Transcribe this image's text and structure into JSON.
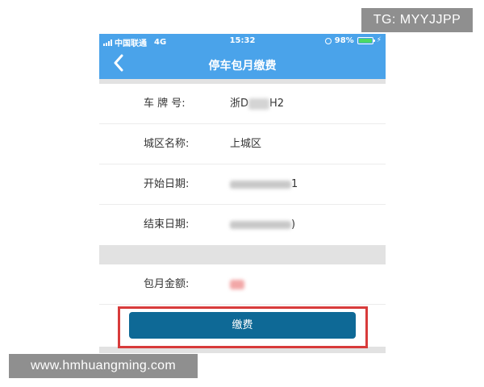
{
  "watermarks": {
    "top": "TG: MYYJJPP",
    "bottom": "www.hmhuangming.com"
  },
  "status_bar": {
    "carrier": "中国联通",
    "network": "4G",
    "time": "15:32",
    "battery": "98%",
    "icons": [
      "signal-icon",
      "lock-rotation-icon",
      "battery-icon",
      "charging-icon"
    ]
  },
  "header": {
    "title": "停车包月缴费",
    "back_icon": "chevron-left-icon"
  },
  "form": {
    "plate": {
      "label": "车 牌 号:",
      "value_prefix": "浙D",
      "value_suffix": "H2"
    },
    "district": {
      "label": "城区名称:",
      "value": "上城区"
    },
    "start_date": {
      "label": "开始日期:",
      "value_suffix": "1"
    },
    "end_date": {
      "label": "结束日期:",
      "value_suffix": ")"
    },
    "amount": {
      "label": "包月金额:"
    }
  },
  "actions": {
    "pay_label": "缴费"
  },
  "colors": {
    "header": "#4aa3ea",
    "pay_button": "#0e6996",
    "highlight": "#d83b3b",
    "divider": "#e2e2e2"
  }
}
